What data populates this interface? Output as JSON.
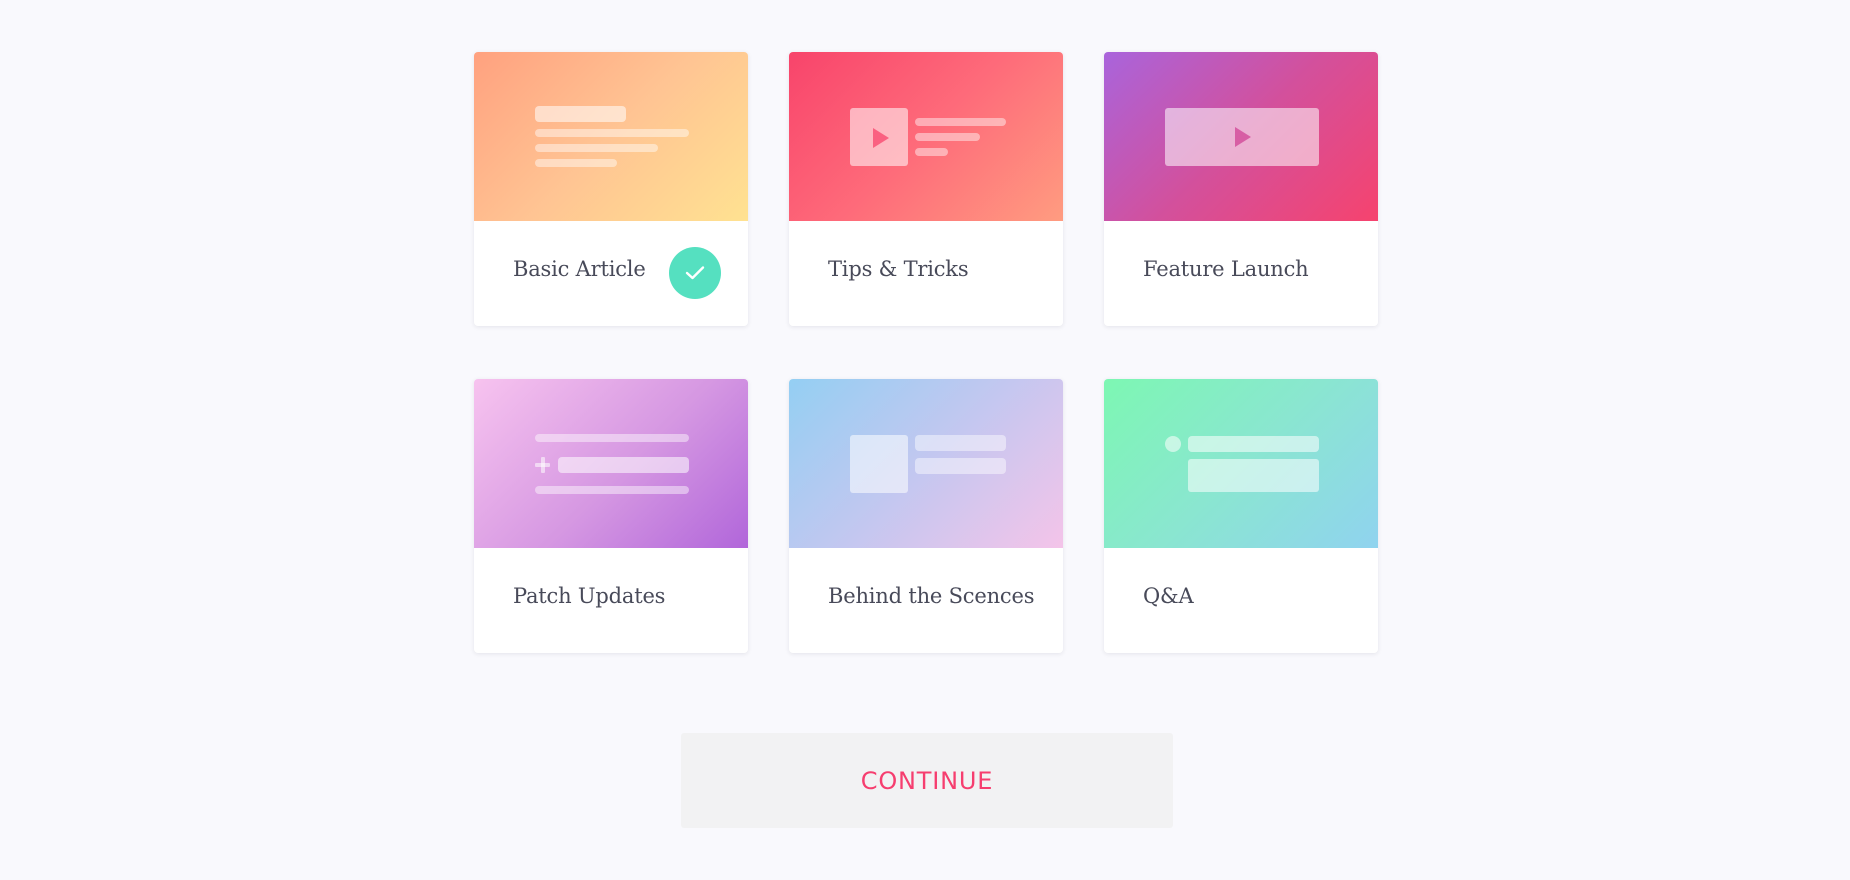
{
  "cards": [
    {
      "label": "Basic Article",
      "selected": true,
      "preview_icon": "article-lines-icon",
      "gradient": [
        "#ffa17f",
        "#ffe291"
      ]
    },
    {
      "label": "Tips & Tricks",
      "selected": false,
      "preview_icon": "video-list-icon",
      "gradient": [
        "#f8446b",
        "#ff9c80"
      ]
    },
    {
      "label": "Feature Launch",
      "selected": false,
      "preview_icon": "video-player-icon",
      "gradient": [
        "#a964dc",
        "#f6436e"
      ]
    },
    {
      "label": "Patch Updates",
      "selected": false,
      "preview_icon": "changelog-icon",
      "gradient": [
        "#f7c3ef",
        "#b166da"
      ]
    },
    {
      "label": "Behind the Scences",
      "selected": false,
      "preview_icon": "media-text-icon",
      "gradient": [
        "#94cff3",
        "#f4c4e9"
      ]
    },
    {
      "label": "Q&A",
      "selected": false,
      "preview_icon": "question-answer-icon",
      "gradient": [
        "#7df7b3",
        "#90d3ef"
      ]
    }
  ],
  "selected_icon": "check-icon",
  "continue_label": "CONTINUE",
  "colors": {
    "background": "#f9f9fd",
    "accent": "#f63e6f",
    "selected_badge": "#55e0c0",
    "label_text": "#484a59",
    "button_bg": "#f2f2f3"
  }
}
